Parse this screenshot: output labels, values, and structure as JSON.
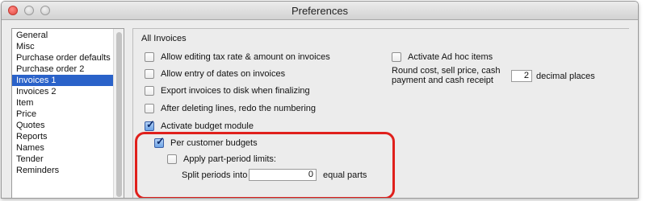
{
  "window": {
    "title": "Preferences"
  },
  "sidebar": {
    "items": [
      {
        "label": "General",
        "selected": false
      },
      {
        "label": "Misc",
        "selected": false
      },
      {
        "label": "Purchase order defaults",
        "selected": false
      },
      {
        "label": "Purchase order 2",
        "selected": false
      },
      {
        "label": "Invoices 1",
        "selected": true
      },
      {
        "label": "Invoices 2",
        "selected": false
      },
      {
        "label": "Item",
        "selected": false
      },
      {
        "label": "Price",
        "selected": false
      },
      {
        "label": "Quotes",
        "selected": false
      },
      {
        "label": "Reports",
        "selected": false
      },
      {
        "label": "Names",
        "selected": false
      },
      {
        "label": "Tender",
        "selected": false
      },
      {
        "label": "Reminders",
        "selected": false
      }
    ]
  },
  "panel": {
    "section_title": "All Invoices",
    "left_options": [
      {
        "label": "Allow editing tax rate & amount on invoices",
        "checked": false
      },
      {
        "label": "Allow entry of dates on invoices",
        "checked": false
      },
      {
        "label": "Export invoices to disk when finalizing",
        "checked": false
      },
      {
        "label": "After deleting lines, redo the numbering",
        "checked": false
      },
      {
        "label": "Activate budget module",
        "checked": true
      },
      {
        "label": "Per customer budgets",
        "checked": true
      },
      {
        "label": "Apply part-period limits:",
        "checked": false
      }
    ],
    "split_periods": {
      "label": "Split periods into",
      "value": "0",
      "suffix": "equal parts"
    },
    "adhoc": {
      "label": "Activate Ad hoc items",
      "checked": false
    },
    "round_cost": {
      "label_line1": "Round cost, sell price, cash",
      "label_line2": "payment and cash receipt",
      "value": "2",
      "suffix": "decimal places"
    }
  },
  "colors": {
    "selection": "#2a62c9",
    "highlight": "#e0201c"
  }
}
